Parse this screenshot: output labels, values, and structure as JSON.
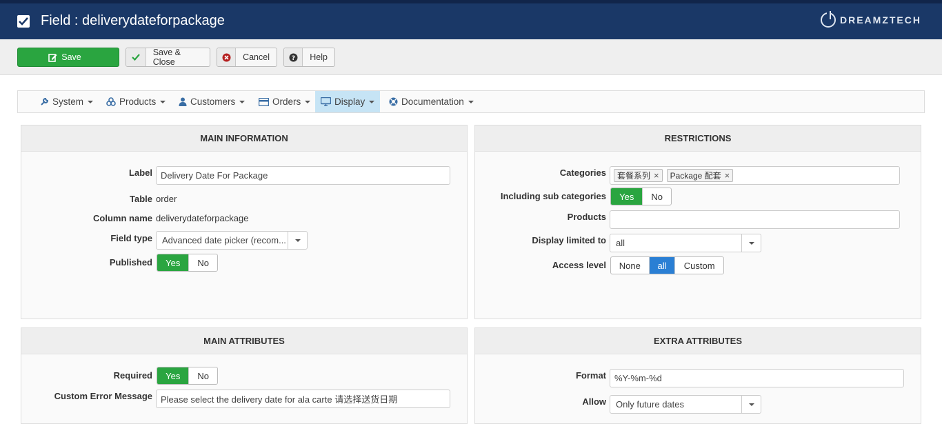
{
  "header": {
    "title": "Field : deliverydateforpackage",
    "brand": "DREAMZTECH"
  },
  "toolbar": {
    "save_label": "Save",
    "save_close_label": "Save & Close",
    "cancel_label": "Cancel",
    "help_label": "Help"
  },
  "nav": {
    "items": [
      {
        "label": "System",
        "icon": "wrench-icon"
      },
      {
        "label": "Products",
        "icon": "cubes-icon"
      },
      {
        "label": "Customers",
        "icon": "user-icon"
      },
      {
        "label": "Orders",
        "icon": "credit-card-icon"
      },
      {
        "label": "Display",
        "icon": "monitor-icon"
      },
      {
        "label": "Documentation",
        "icon": "lifebuoy-icon"
      }
    ]
  },
  "main_info": {
    "heading": "MAIN INFORMATION",
    "label_label": "Label",
    "label_value": "Delivery Date For Package",
    "table_label": "Table",
    "table_value": "order",
    "column_label": "Column name",
    "column_value": "deliverydateforpackage",
    "fieldtype_label": "Field type",
    "fieldtype_value": "Advanced date picker (recom...",
    "published_label": "Published",
    "yes": "Yes",
    "no": "No"
  },
  "restrictions": {
    "heading": "RESTRICTIONS",
    "categories_label": "Categories",
    "categories": [
      "套餐系列",
      "Package 配套"
    ],
    "subcat_label": "Including sub categories",
    "products_label": "Products",
    "display_limited_label": "Display limited to",
    "display_limited_value": "all",
    "access_label": "Access level",
    "access_options": [
      "None",
      "all",
      "Custom"
    ],
    "yes": "Yes",
    "no": "No"
  },
  "main_attributes": {
    "heading": "MAIN ATTRIBUTES",
    "required_label": "Required",
    "error_label": "Custom Error Message",
    "error_value": "Please select the delivery date for ala carte 请选择送货日期",
    "yes": "Yes",
    "no": "No"
  },
  "extra_attributes": {
    "heading": "EXTRA ATTRIBUTES",
    "format_label": "Format",
    "format_value": "%Y-%m-%d",
    "allow_label": "Allow",
    "allow_value": "Only future dates"
  },
  "colors": {
    "header_bg": "#1a3867",
    "green": "#2aa540",
    "blue": "#2a7fd4",
    "active_nav": "#c6e4f5"
  }
}
